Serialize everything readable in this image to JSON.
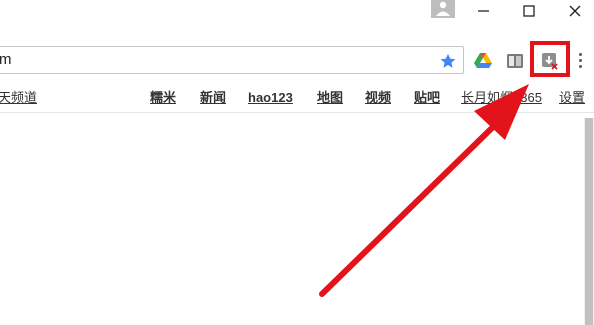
{
  "window": {
    "minimize_label": "—",
    "maximize_label": "☐",
    "close_label": "✕"
  },
  "address_bar": {
    "url_text": "m"
  },
  "bookmarks": [
    {
      "label": "天频道"
    },
    {
      "label": "糯米"
    },
    {
      "label": "新闻"
    },
    {
      "label": "hao123"
    },
    {
      "label": "地图"
    },
    {
      "label": "视频"
    },
    {
      "label": "贴吧"
    },
    {
      "label": "长月如烟_365"
    },
    {
      "label": "设置"
    }
  ],
  "icons": {
    "account": "person-icon",
    "bookmark_star": "star-icon",
    "extension_1": "google-drive-icon",
    "extension_2": "reader-mode-icon",
    "extension_3": "download-blocked-icon",
    "menu": "more-vertical-icon"
  },
  "colors": {
    "highlight": "#e3131b",
    "arrow": "#e3131b",
    "star": "#4285f4"
  }
}
